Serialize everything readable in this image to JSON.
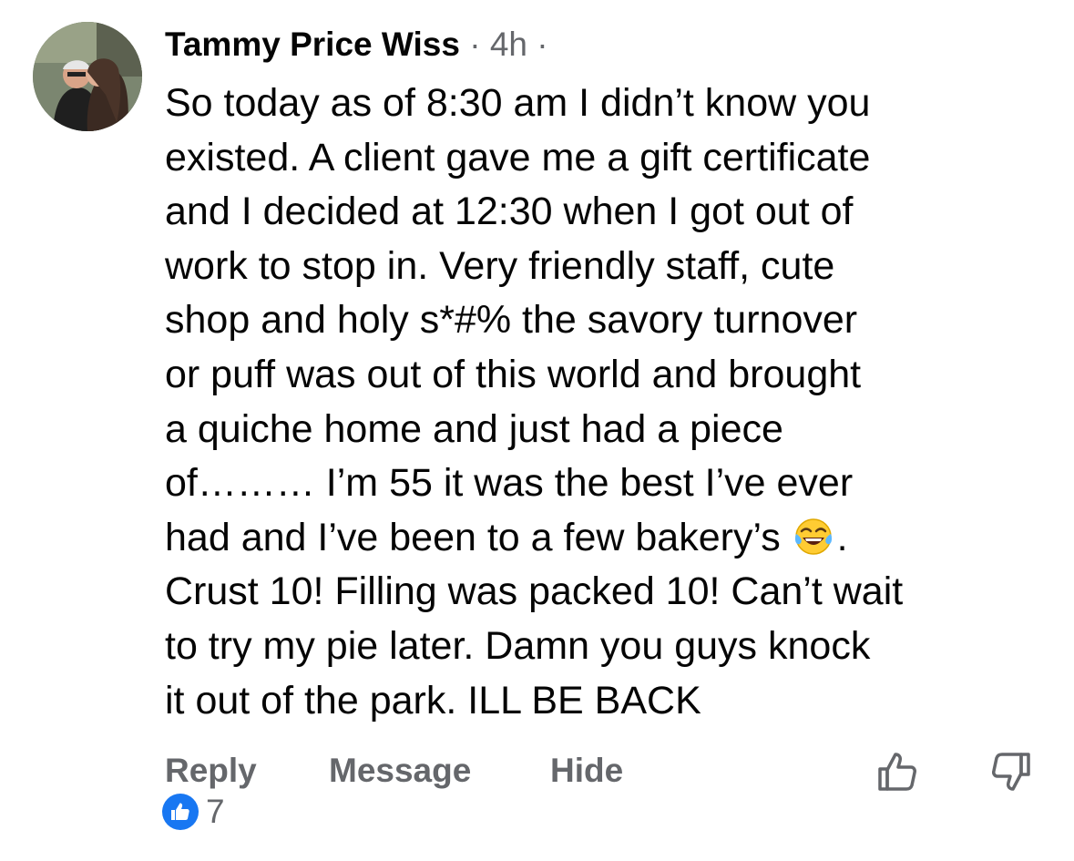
{
  "comment": {
    "author": "Tammy Price Wiss",
    "separator_1": " · ",
    "timestamp": "4h",
    "separator_2": " ·",
    "text_lines": [
      "So today as of 8:30 am I didn’t know you",
      "existed. A client gave me a gift certificate",
      "and I decided at 12:30 when I got out of",
      "work to stop in. Very friendly staff, cute",
      "shop and holy s*#% the savory turnover",
      "or puff was out of this world and brought",
      "a quiche home and just had a piece",
      "of……… I’m 55 it was the best I’ve ever",
      "had and I’ve been to a few bakery’s",
      ".",
      "Crust 10! Filling was packed 10! Can’t wait",
      "to try my pie later. Damn you guys knock",
      "it out of the park. ILL BE BACK"
    ],
    "inline_emoji": "laughing-tears-emoji"
  },
  "actions": {
    "reply_label": "Reply",
    "message_label": "Message",
    "hide_label": "Hide"
  },
  "reactions": {
    "like_count": "7",
    "icon": "like-badge-icon"
  },
  "colors": {
    "text": "#050505",
    "secondary": "#65676b",
    "like_blue": "#1877f2"
  }
}
